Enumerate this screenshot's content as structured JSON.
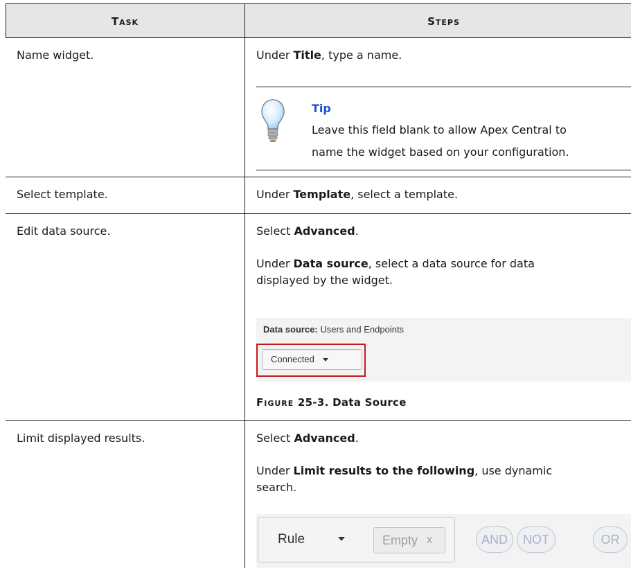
{
  "headers": {
    "task": "Task",
    "steps": "Steps"
  },
  "rows": [
    {
      "task": "Name widget.",
      "step_pre": "Under ",
      "step_bold": "Title",
      "step_post": ", type a name.",
      "tip": {
        "label": "Tip",
        "line1": "Leave this field blank to allow Apex Central to",
        "line2": "name the widget based on your configuration."
      }
    },
    {
      "task": "Select template.",
      "step_pre": "Under ",
      "step_bold": "Template",
      "step_post": ", select a template."
    },
    {
      "task": "Edit data source.",
      "select_pre": "Select ",
      "select_bold": "Advanced",
      "select_post": ".",
      "step_pre": "Under ",
      "step_bold": "Data source",
      "step_post_line1": ", select a data source for data",
      "step_post_line2": "displayed by the widget.",
      "figure": {
        "label_bold": "Data source:",
        "label_value": "Users and Endpoints",
        "button": "Connected",
        "caption_prefix": "Figure",
        "caption_rest": "25-3. Data Source"
      }
    },
    {
      "task": "Limit displayed results.",
      "select_pre": "Select ",
      "select_bold": "Advanced",
      "select_post": ".",
      "step_pre": "Under ",
      "step_bold": "Limit results to the following",
      "step_post_line1": ", use dynamic",
      "step_post_line2": "search.",
      "search": {
        "rule": "Rule",
        "empty": "Empty",
        "remove": "x",
        "and": "AND",
        "not": "NOT",
        "or": "OR"
      }
    }
  ]
}
